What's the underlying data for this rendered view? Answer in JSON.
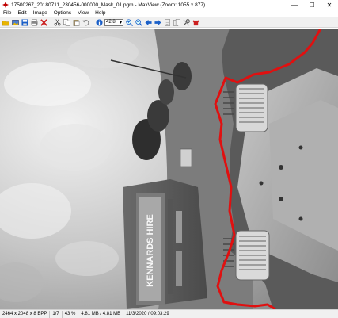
{
  "window": {
    "title": "17500267_20180711_230456-000000_Mask_01.pgm - MaxView (Zoom: 1055 x 877)",
    "minimize_glyph": "—",
    "maximize_glyph": "☐",
    "close_glyph": "✕"
  },
  "menu": {
    "items": [
      "File",
      "Edit",
      "Image",
      "Options",
      "View",
      "Help"
    ]
  },
  "toolbar": {
    "zoom_value": "42.8",
    "icons": [
      "open-icon",
      "image-icon",
      "save-icon",
      "print-icon",
      "delete-icon",
      "cut-icon",
      "copy-icon",
      "paste-icon",
      "undo-icon",
      "info-icon",
      "zoom-in-icon",
      "zoom-out-icon",
      "prev-arrow-icon",
      "next-arrow-icon",
      "page-icon",
      "page2-icon",
      "settings-icon",
      "exit-icon"
    ],
    "colors": {
      "red": "#cc2020",
      "blue": "#1a5fc8",
      "yellow": "#e8b400"
    }
  },
  "image": {
    "overlay_color": "#e01010",
    "sign_text": "KENNARDS HIRE"
  },
  "status": {
    "dimensions": "2464 x 2048 x 8 BPP",
    "page": "1/7",
    "zoom": "43 %",
    "memory": "4.81 MB / 4.81 MB",
    "datetime": "11/3/2020 / 09:03:29"
  }
}
